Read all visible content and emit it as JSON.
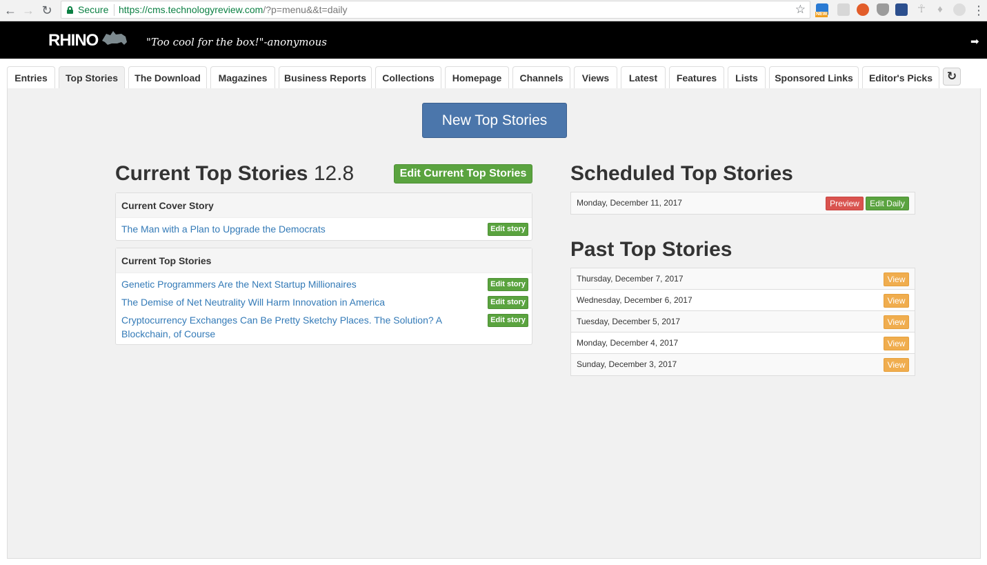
{
  "browser": {
    "secure_label": "Secure",
    "url_host": "https://cms.technologyreview.com",
    "url_rest": "/?p=menu&&t=daily",
    "ext_new_badge": "NEW"
  },
  "header": {
    "logo": "RHINO",
    "tagline": "\"Too cool for the box!\"-anonymous"
  },
  "tabs": [
    {
      "label": "Entries"
    },
    {
      "label": "Top Stories"
    },
    {
      "label": "The Download"
    },
    {
      "label": "Magazines"
    },
    {
      "label": "Business Reports"
    },
    {
      "label": "Collections"
    },
    {
      "label": "Homepage"
    },
    {
      "label": "Channels"
    },
    {
      "label": "Views"
    },
    {
      "label": "Latest"
    },
    {
      "label": "Features"
    },
    {
      "label": "Lists"
    },
    {
      "label": "Sponsored Links"
    },
    {
      "label": "Editor's Picks"
    }
  ],
  "main": {
    "new_button": "New Top Stories",
    "current": {
      "title": "Current Top Stories",
      "version": "12.8",
      "edit_button": "Edit Current Top Stories",
      "cover_heading": "Current Cover Story",
      "cover_story": "The Man with a Plan to Upgrade the Democrats",
      "top_heading": "Current Top Stories",
      "stories": [
        "Genetic Programmers Are the Next Startup Millionaires",
        "The Demise of Net Neutrality Will Harm Innovation in America",
        "Cryptocurrency Exchanges Can Be Pretty Sketchy Places. The Solution? A",
        "Blockchain, of Course"
      ],
      "edit_story_label": "Edit story"
    },
    "scheduled": {
      "title": "Scheduled Top Stories",
      "date": "Monday, December 11, 2017",
      "preview_label": "Preview",
      "edit_label": "Edit Daily"
    },
    "past": {
      "title": "Past Top Stories",
      "view_label": "View",
      "dates": [
        "Thursday, December 7, 2017",
        "Wednesday, December 6, 2017",
        "Tuesday, December 5, 2017",
        "Monday, December 4, 2017",
        "Sunday, December 3, 2017"
      ]
    }
  },
  "colors": {
    "primary": "#4b76ab",
    "success": "#5aa33f",
    "danger": "#d9534f",
    "warning": "#f0ad4e",
    "link": "#337ab7"
  }
}
